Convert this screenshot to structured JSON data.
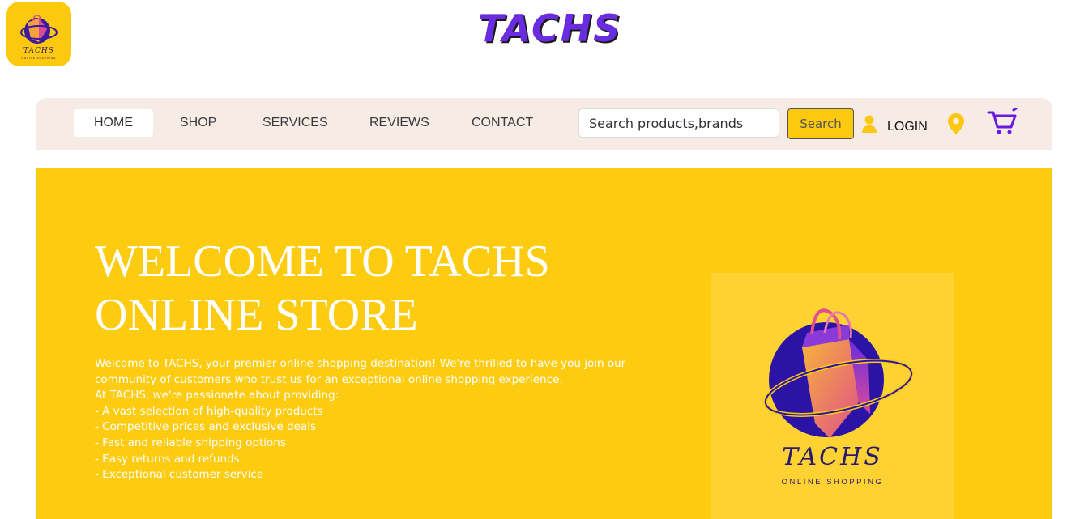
{
  "brand": {
    "wordmark": "TACHS",
    "logo_name": "TACHS",
    "logo_tagline": "ONLINE SHOPPING"
  },
  "nav": {
    "items": [
      {
        "label": "HOME",
        "active": true
      },
      {
        "label": "SHOP"
      },
      {
        "label": "SERVICES"
      },
      {
        "label": "REVIEWS"
      },
      {
        "label": "CONTACT"
      }
    ],
    "search_placeholder": "Search products,brands",
    "search_button": "Search",
    "login_label": "LOGIN",
    "icons": [
      "user-icon",
      "location-pin-icon",
      "cart-icon"
    ]
  },
  "hero": {
    "title_line1": "WELCOME TO TACHS",
    "title_line2": "ONLINE STORE",
    "lines": [
      "Welcome to TACHS, your premier online shopping destination! We're thrilled to have you join our",
      "community of customers who trust us for an exceptional online shopping experience.",
      "At TACHS, we're passionate about providing:",
      "- A vast selection of high-quality products",
      "- Competitive prices and exclusive deals",
      "- Fast and reliable shipping options",
      "- Easy returns and refunds",
      "- Exceptional customer service"
    ]
  },
  "colors": {
    "accent_yellow": "#fdcb0f",
    "nav_bg": "#f7ebe6",
    "brand_purple": "#6a2ce0",
    "logo_navy": "#2a1a6e"
  }
}
